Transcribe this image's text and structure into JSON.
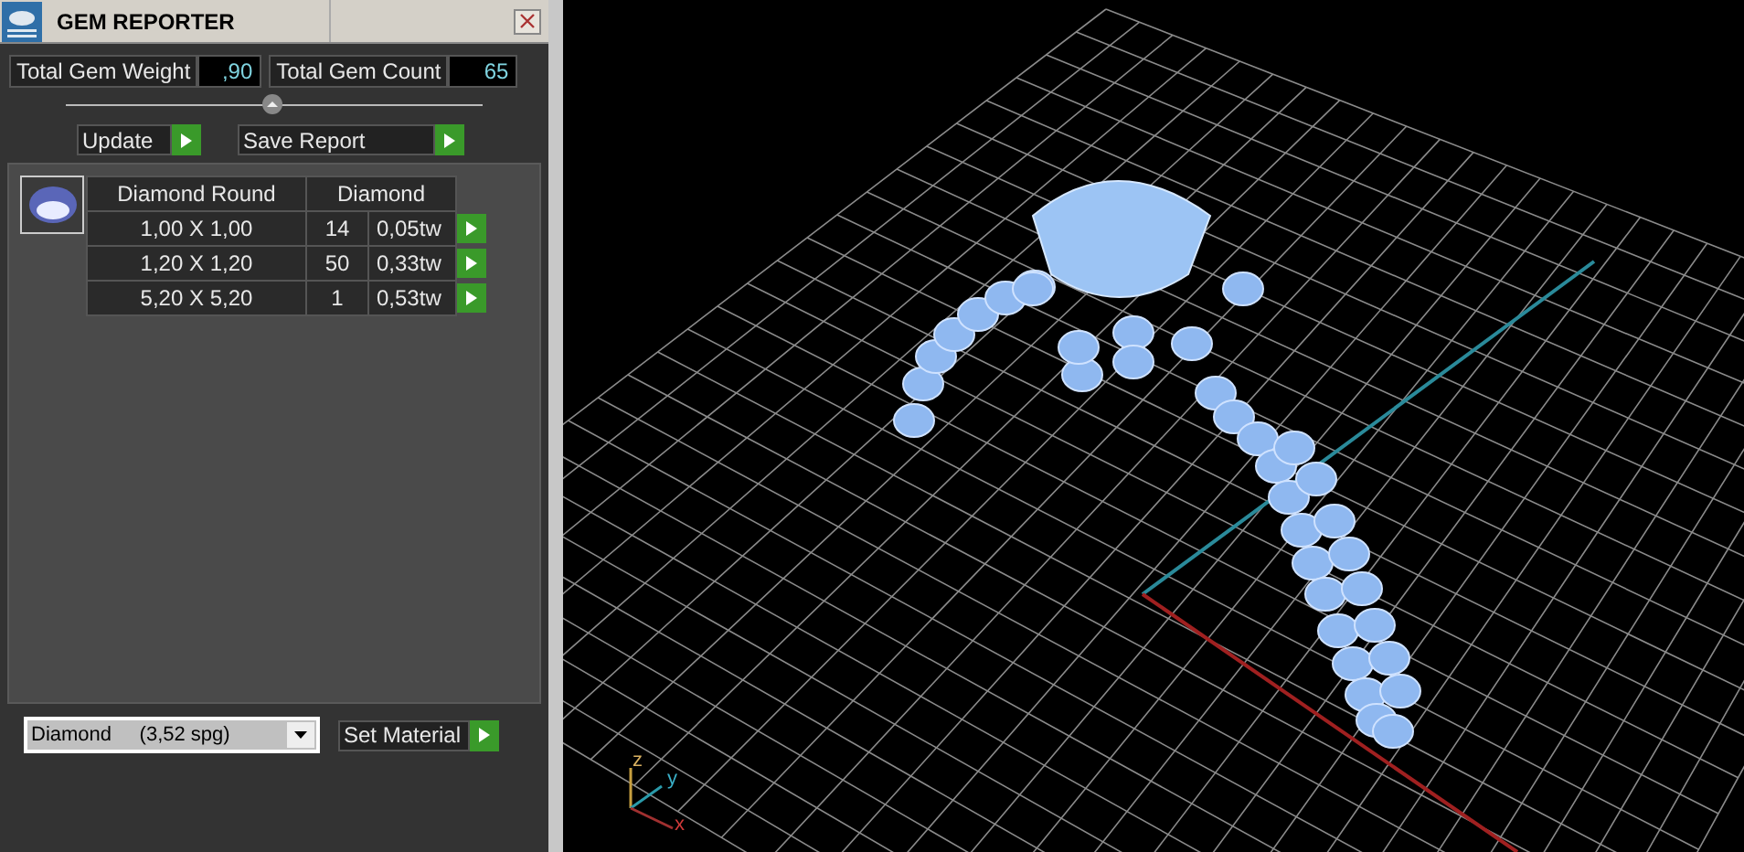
{
  "window": {
    "title": "GEM REPORTER"
  },
  "totals": [
    {
      "label": "Total Gem Weight",
      "value": ",90"
    },
    {
      "label": "Total Gem Count",
      "value": "65"
    }
  ],
  "actions": [
    {
      "label": "Update"
    },
    {
      "label": "Save Report"
    }
  ],
  "table": {
    "columns": [
      "Diamond Round",
      "Diamond"
    ],
    "rows": [
      {
        "size": "1,00 X 1,00",
        "count": "14",
        "weight": "0,05tw"
      },
      {
        "size": "1,20 X 1,20",
        "count": "50",
        "weight": "0,33tw"
      },
      {
        "size": "5,20 X 5,20",
        "count": "1",
        "weight": "0,53tw"
      }
    ]
  },
  "material": {
    "value": "Diamond     (3,52 spg)",
    "button": "Set Material"
  },
  "viewport": {
    "axes": [
      "z",
      "y",
      "x"
    ]
  }
}
